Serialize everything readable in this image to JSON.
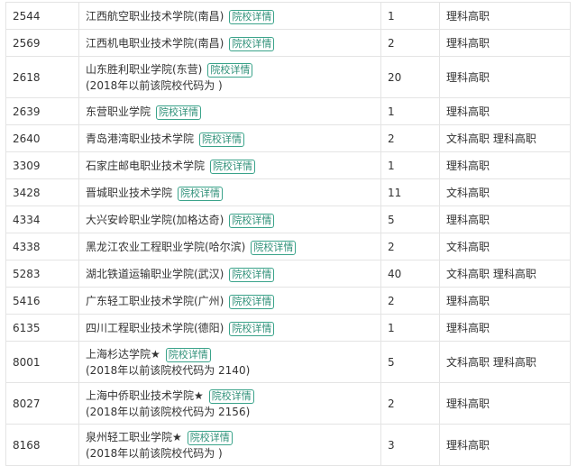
{
  "badge_label": "院校详情",
  "rows": [
    {
      "code": "2544",
      "name": "江西航空职业技术学院(南昌)",
      "note": "",
      "count": "1",
      "type": "理科高职"
    },
    {
      "code": "2569",
      "name": "江西机电职业技术学院(南昌)",
      "note": "",
      "count": "2",
      "type": "理科高职"
    },
    {
      "code": "2618",
      "name": "山东胜利职业学院(东营)",
      "note": "(2018年以前该院校代码为 )",
      "count": "20",
      "type": "理科高职"
    },
    {
      "code": "2639",
      "name": "东营职业学院",
      "note": "",
      "count": "1",
      "type": "理科高职"
    },
    {
      "code": "2640",
      "name": "青岛港湾职业技术学院",
      "note": "",
      "count": "2",
      "type": "文科高职 理科高职"
    },
    {
      "code": "3309",
      "name": "石家庄邮电职业技术学院",
      "note": "",
      "count": "1",
      "type": "理科高职"
    },
    {
      "code": "3428",
      "name": "晋城职业技术学院",
      "note": "",
      "count": "11",
      "type": "文科高职"
    },
    {
      "code": "4334",
      "name": "大兴安岭职业学院(加格达奇)",
      "note": "",
      "count": "5",
      "type": "理科高职"
    },
    {
      "code": "4338",
      "name": "黑龙江农业工程职业学院(哈尔滨)",
      "note": "",
      "count": "2",
      "type": "文科高职"
    },
    {
      "code": "5283",
      "name": "湖北铁道运输职业学院(武汉)",
      "note": "",
      "count": "40",
      "type": "文科高职 理科高职"
    },
    {
      "code": "5416",
      "name": "广东轻工职业技术学院(广州)",
      "note": "",
      "count": "2",
      "type": "理科高职"
    },
    {
      "code": "6135",
      "name": "四川工程职业技术学院(德阳)",
      "note": "",
      "count": "1",
      "type": "理科高职"
    },
    {
      "code": "8001",
      "name": "上海杉达学院★",
      "note": "(2018年以前该院校代码为 2140)",
      "count": "5",
      "type": "文科高职 理科高职"
    },
    {
      "code": "8027",
      "name": "上海中侨职业技术学院★",
      "note": "(2018年以前该院校代码为 2156)",
      "count": "2",
      "type": "理科高职"
    },
    {
      "code": "8168",
      "name": "泉州轻工职业学院★",
      "note": "(2018年以前该院校代码为 )",
      "count": "3",
      "type": "理科高职"
    }
  ]
}
